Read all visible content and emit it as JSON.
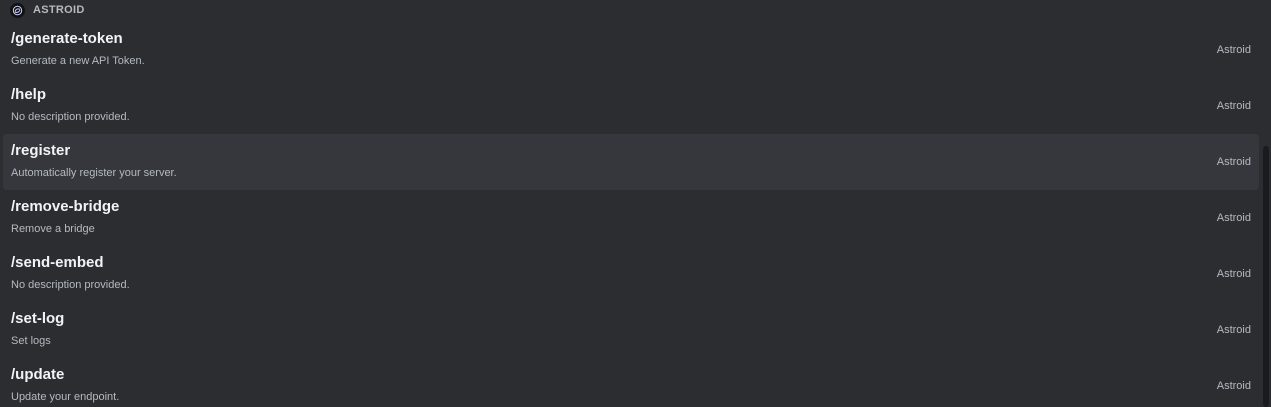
{
  "section": {
    "title": "ASTROID",
    "icon": "astroid-bot-avatar-icon"
  },
  "commands": [
    {
      "name": "/generate-token",
      "description": "Generate a new API Token.",
      "source": "Astroid"
    },
    {
      "name": "/help",
      "description": "No description provided.",
      "source": "Astroid"
    },
    {
      "name": "/register",
      "description": "Automatically register your server.",
      "source": "Astroid",
      "selected": true
    },
    {
      "name": "/remove-bridge",
      "description": "Remove a bridge",
      "source": "Astroid"
    },
    {
      "name": "/send-embed",
      "description": "No description provided.",
      "source": "Astroid"
    },
    {
      "name": "/set-log",
      "description": "Set logs",
      "source": "Astroid"
    },
    {
      "name": "/update",
      "description": "Update your endpoint.",
      "source": "Astroid"
    }
  ],
  "colors": {
    "background": "#2b2d31",
    "selected_row": "#35373c",
    "primary_text": "#f2f3f5",
    "secondary_text": "#b5bac1"
  }
}
